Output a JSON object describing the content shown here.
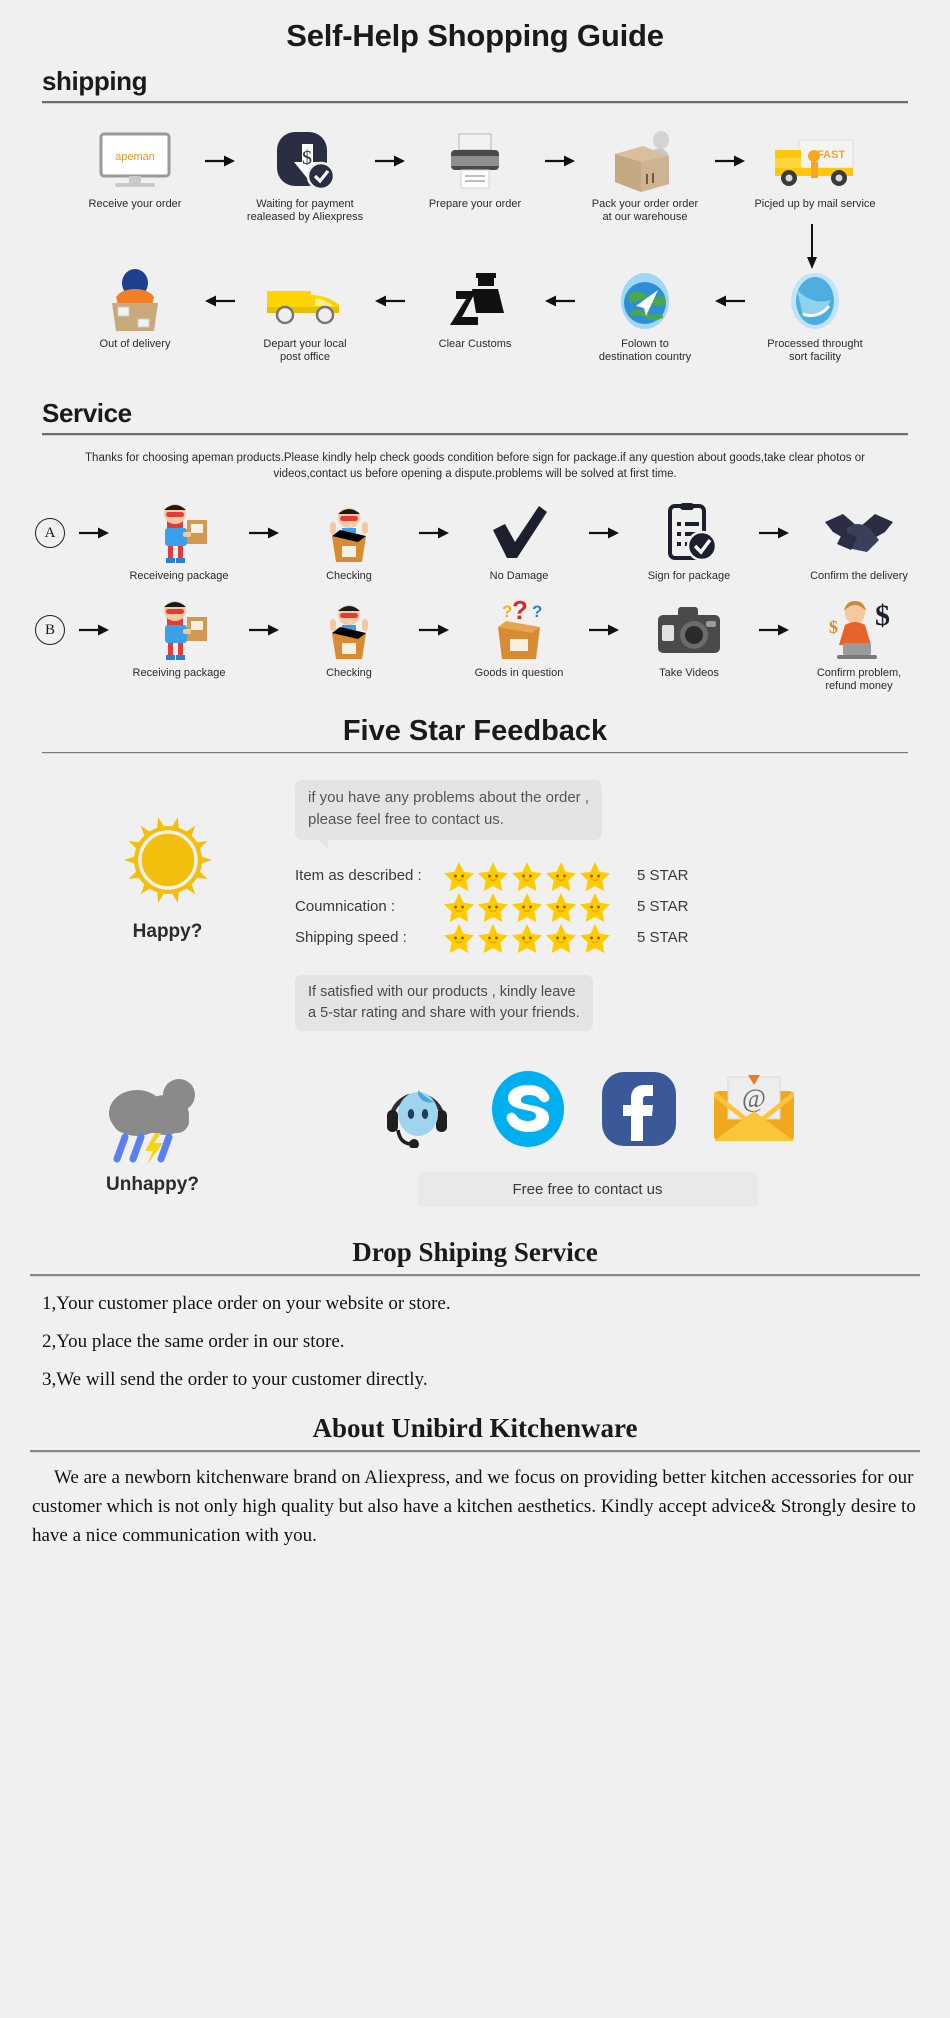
{
  "title": "Self-Help Shopping Guide",
  "shipping": {
    "heading": "shipping",
    "row1": [
      {
        "icon": "monitor-apeman-icon",
        "caption": "Receive your order"
      },
      {
        "icon": "payment-dollar-check-icon",
        "caption": "Waiting for payment\nrealeased by Aliexpress"
      },
      {
        "icon": "printer-icon",
        "caption": "Prepare your order"
      },
      {
        "icon": "packing-box-worker-icon",
        "caption": "Pack your order order\nat our warehouse"
      },
      {
        "icon": "delivery-truck-fast-icon",
        "caption": "Picjed up by mail service"
      }
    ],
    "row2": [
      {
        "icon": "box-courier-icon",
        "caption": "Out of delivery"
      },
      {
        "icon": "yellow-van-icon",
        "caption": "Depart your local\npost office"
      },
      {
        "icon": "customs-officer-icon",
        "caption": "Clear Customs"
      },
      {
        "icon": "globe-airplane-icon",
        "caption": "Folown to\ndestination country"
      },
      {
        "icon": "blue-sort-globe-icon",
        "caption": "Processed throught\nsort facility"
      }
    ]
  },
  "service": {
    "heading": "Service",
    "blurb": "Thanks for choosing apeman products.Please kindly help check goods condition before sign for package.if any question about goods,take clear photos or videos,contact us before opening a dispute.problems will be solved at first time.",
    "rowA": {
      "badge": "A",
      "steps": [
        {
          "icon": "hero-with-package-icon",
          "caption": "Receiveing package"
        },
        {
          "icon": "hero-opening-box-icon",
          "caption": "Checking"
        },
        {
          "icon": "checkmark-icon",
          "caption": "No Damage"
        },
        {
          "icon": "signed-document-icon",
          "caption": "Sign for package"
        },
        {
          "icon": "handshake-icon",
          "caption": "Confirm the delivery"
        }
      ]
    },
    "rowB": {
      "badge": "B",
      "steps": [
        {
          "icon": "hero-with-package-icon",
          "caption": "Receiving package"
        },
        {
          "icon": "hero-opening-box-icon",
          "caption": "Checking"
        },
        {
          "icon": "question-box-icon",
          "caption": "Goods in question"
        },
        {
          "icon": "camera-icon",
          "caption": "Take Videos"
        },
        {
          "icon": "refund-agent-dollar-icon",
          "caption": "Confirm problem,\nrefund money"
        }
      ]
    }
  },
  "feedback": {
    "heading": "Five Star Feedback",
    "bubble_top": "if you have any problems about the order ,\nplease feel free to contact us.",
    "bubble_bottom": "If satisfied with our products ,  kindly leave\na 5-star rating and share with your friends.",
    "happy_label": "Happy?",
    "unhappy_label": "Unhappy?",
    "contact_bar": "Free free to contact us",
    "ratings": [
      {
        "label": "Item as described :",
        "stars": 5,
        "value": "5 STAR"
      },
      {
        "label": "Coumnication :",
        "stars": 5,
        "value": "5 STAR"
      },
      {
        "label": "Shipping speed :",
        "stars": 5,
        "value": "5 STAR"
      }
    ],
    "socials": [
      {
        "icon": "support-headset-icon",
        "name": "Live Support"
      },
      {
        "icon": "skype-icon",
        "name": "Skype"
      },
      {
        "icon": "facebook-icon",
        "name": "Facebook"
      },
      {
        "icon": "email-envelope-icon",
        "name": "Email"
      }
    ]
  },
  "dropship": {
    "heading": "Drop Shiping Service",
    "items": [
      "1,Your customer place order on your website or store.",
      "2,You place the same order in our store.",
      "3,We will send the order to your customer directly."
    ]
  },
  "about": {
    "heading": "About Unibird Kitchenware",
    "body": "We are a newborn kitchenware brand on Aliexpress, and we focus on providing better kitchen accessories for our customer which is not only high quality but also have a kitchen aesthetics. Kindly accept advice& Strongly desire to have a nice communication with you."
  },
  "colors": {
    "bg": "#f0f0f0",
    "sun": "#f2c00c",
    "star": "#ffcc00",
    "skype": "#00aff0",
    "facebook": "#3b5998",
    "envelope": "#fbbf24",
    "dark": "#2b2d42"
  }
}
